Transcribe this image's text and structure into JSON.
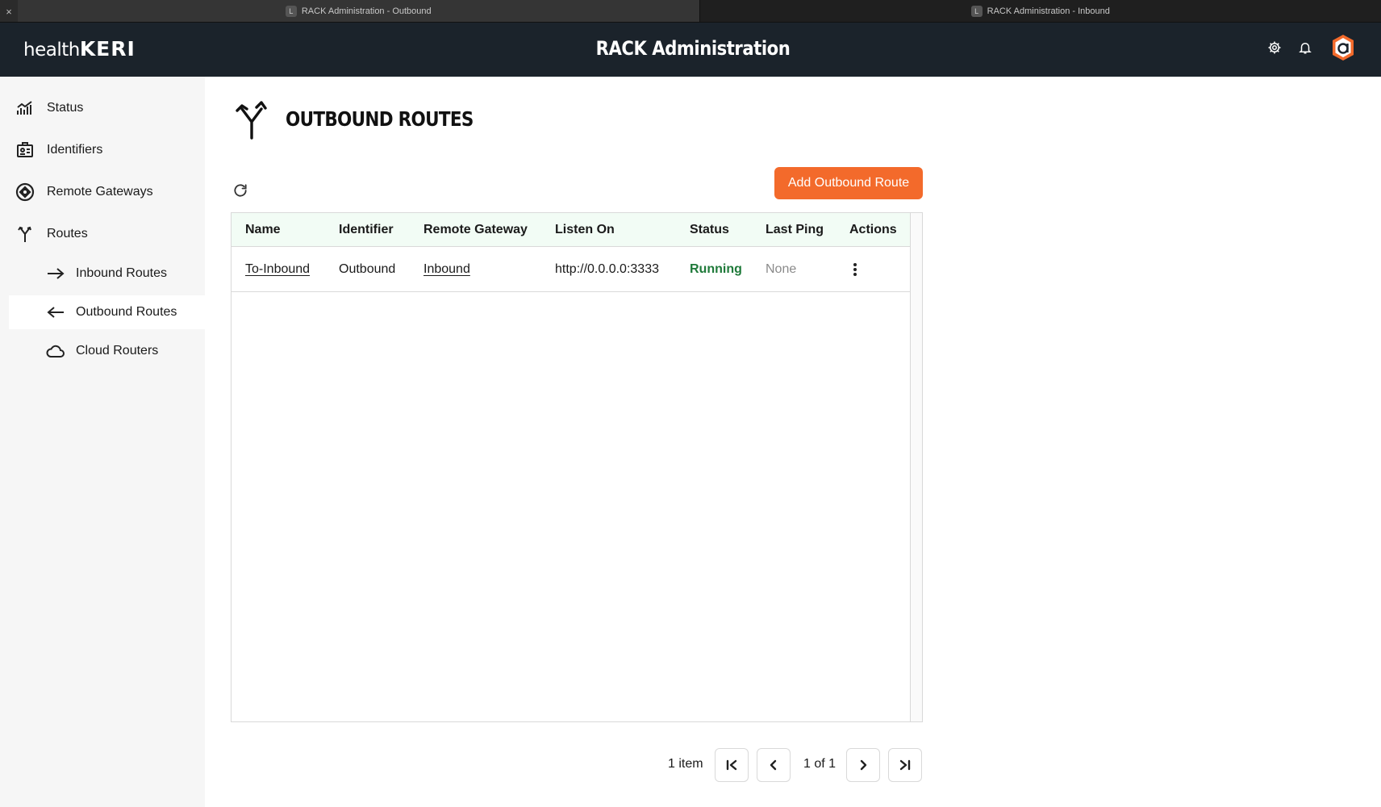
{
  "browser": {
    "tabs": [
      {
        "favicon": "L",
        "title": "RACK Administration - Outbound"
      },
      {
        "favicon": "L",
        "title": "RACK Administration - Inbound"
      }
    ],
    "close_glyph": "×"
  },
  "header": {
    "logo_part1": "health",
    "logo_part2": "KERI",
    "title": "RACK Administration",
    "icons": [
      "gear-icon",
      "bell-icon",
      "account-shield-icon"
    ]
  },
  "sidebar": {
    "items": [
      {
        "label": "Status",
        "icon": "chart-icon"
      },
      {
        "label": "Identifiers",
        "icon": "id-card-icon"
      },
      {
        "label": "Remote Gateways",
        "icon": "gateway-icon"
      },
      {
        "label": "Routes",
        "icon": "fork-arrows-icon"
      },
      {
        "label": "Inbound Routes",
        "icon": "arrow-right-icon"
      },
      {
        "label": "Outbound Routes",
        "icon": "arrow-left-icon",
        "selected": true
      },
      {
        "label": "Cloud Routers",
        "icon": "cloud-icon"
      }
    ]
  },
  "main": {
    "title": "OUTBOUND ROUTES",
    "add_button": "Add Outbound Route",
    "columns": [
      "Name",
      "Identifier",
      "Remote Gateway",
      "Listen On",
      "Status",
      "Last Ping",
      "Actions"
    ],
    "rows": [
      {
        "name": "To-Inbound",
        "identifier": "Outbound",
        "remote_gateway": "Inbound",
        "listen_on": "http://0.0.0.0:3333",
        "status": "Running",
        "last_ping": "None"
      }
    ]
  },
  "pager": {
    "count": "1 item",
    "page": "1 of 1"
  },
  "colors": {
    "accent": "#f36a2b",
    "header_bg": "#1b232b",
    "running": "#1f7a3a",
    "grid_header_bg": "#f2fcf5"
  }
}
